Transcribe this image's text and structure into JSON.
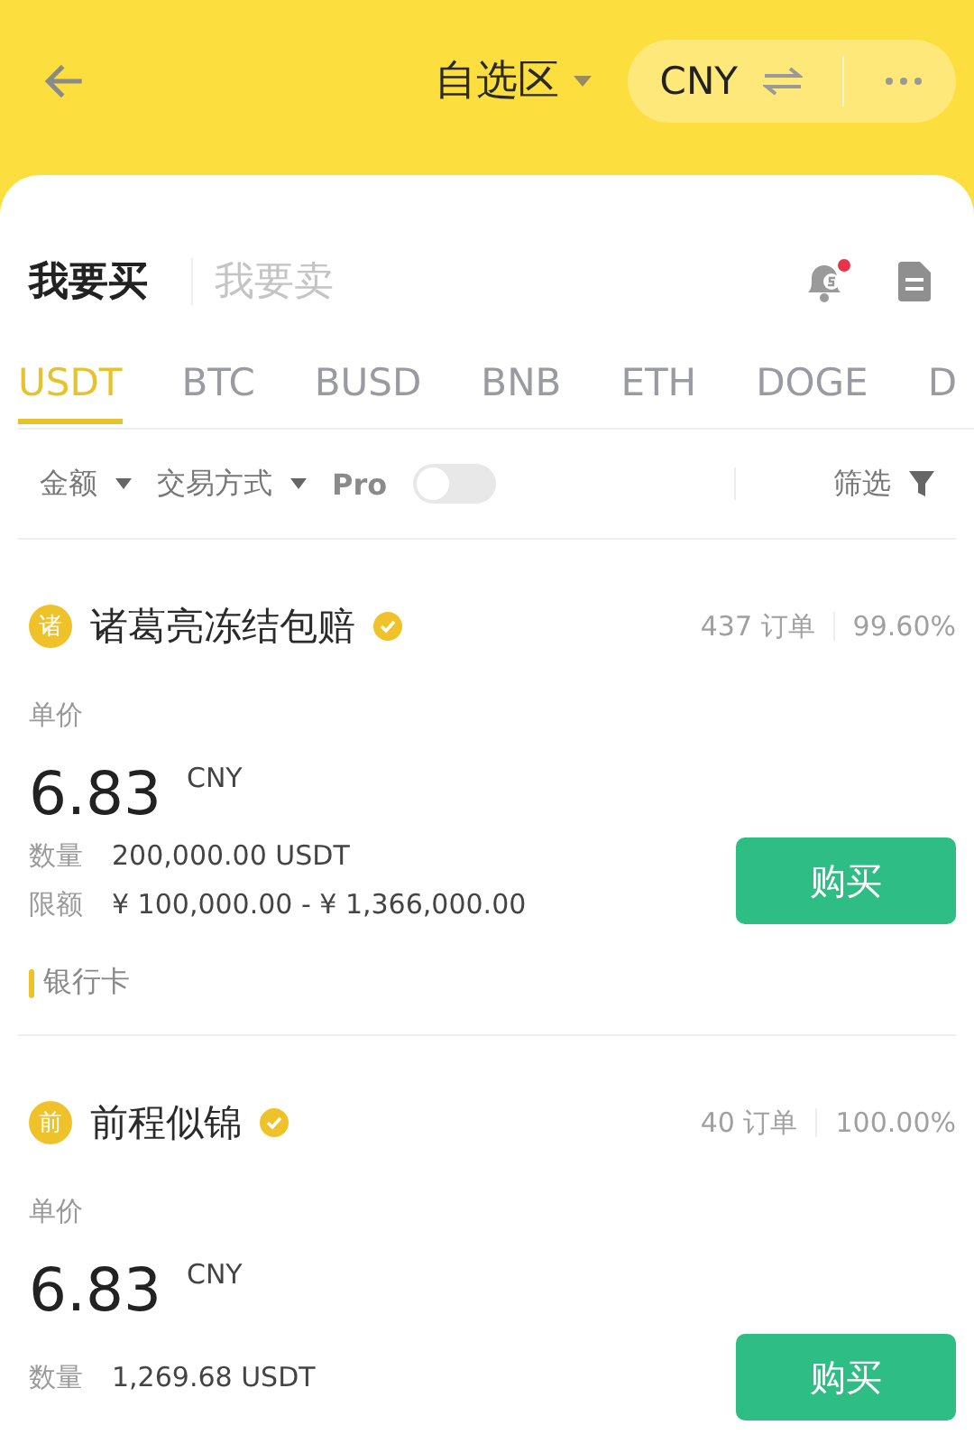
{
  "header": {
    "title": "自选区",
    "currency": "CNY"
  },
  "side_tabs": [
    {
      "label": "我要买",
      "selected": true
    },
    {
      "label": "我要卖",
      "selected": false
    }
  ],
  "notification": {
    "unread": true
  },
  "asset_tabs": [
    {
      "label": "USDT",
      "selected": true
    },
    {
      "label": "BTC",
      "selected": false
    },
    {
      "label": "BUSD",
      "selected": false
    },
    {
      "label": "BNB",
      "selected": false
    },
    {
      "label": "ETH",
      "selected": false
    },
    {
      "label": "DOGE",
      "selected": false
    },
    {
      "label": "D",
      "selected": false
    }
  ],
  "filters": {
    "amount": "金额",
    "payment": "交易方式",
    "pro_label": "Pro",
    "pro_on": false,
    "filter": "筛选"
  },
  "listings": [
    {
      "avatar": "诸",
      "name": "诸葛亮冻结包赔",
      "verified": true,
      "orders": "437 订单",
      "completion": "99.60%",
      "price_label": "单价",
      "price": "6.83",
      "currency": "CNY",
      "quantity_label": "数量",
      "quantity": "200,000.00 USDT",
      "limit_label": "限额",
      "limit": "¥ 100,000.00 - ¥ 1,366,000.00",
      "payment": "银行卡",
      "button": "购买"
    },
    {
      "avatar": "前",
      "name": "前程似锦",
      "verified": true,
      "orders": "40 订单",
      "completion": "100.00%",
      "price_label": "单价",
      "price": "6.83",
      "currency": "CNY",
      "quantity_label": "数量",
      "quantity": "1,269.68 USDT",
      "button": "购买"
    }
  ]
}
